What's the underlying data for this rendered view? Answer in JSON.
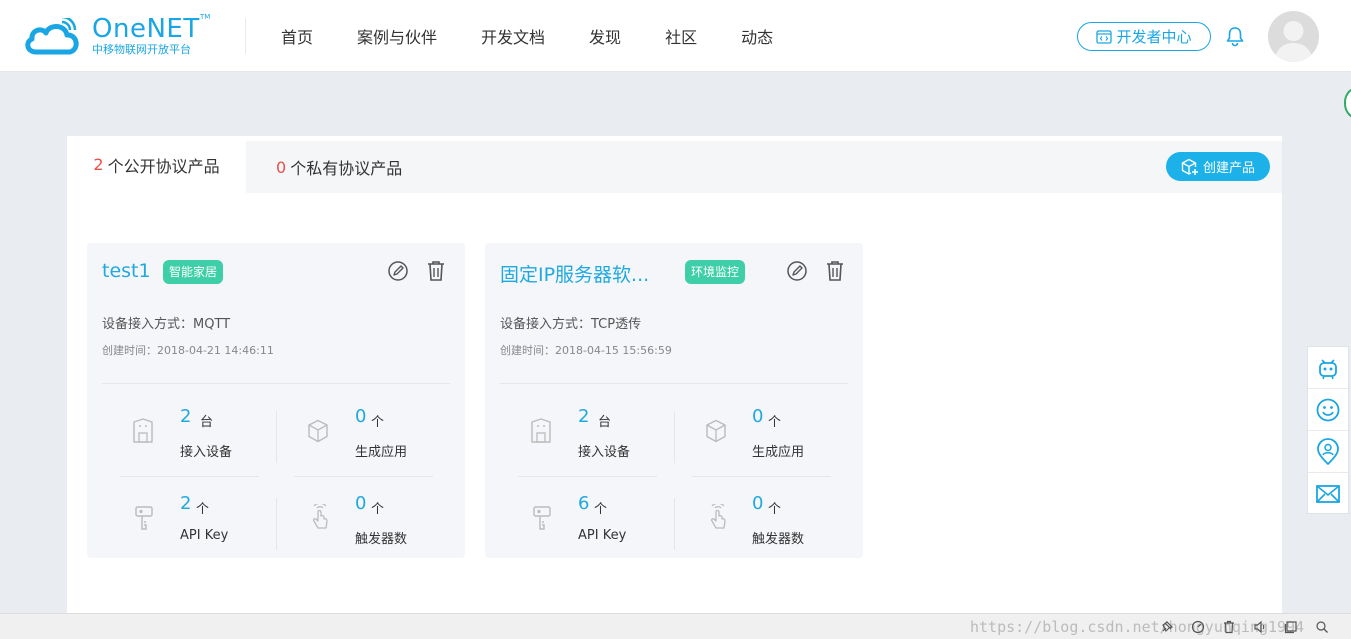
{
  "header": {
    "logo_name": "OneNET",
    "logo_tm": "TM",
    "logo_subtitle": "中移物联网开放平台",
    "nav": [
      "首页",
      "案例与伙伴",
      "开发文档",
      "发现",
      "社区",
      "动态"
    ],
    "dev_center_label": "开发者中心"
  },
  "tabs": {
    "public_count": "2",
    "public_label": "个公开协议产品",
    "private_count": "0",
    "private_label": "个私有协议产品"
  },
  "create_label": "创建产品",
  "products": [
    {
      "title": "test1",
      "tag": "智能家居",
      "access": "设备接入方式：MQTT",
      "created": "创建时间：2018-04-21 14:46:11",
      "devices_value": "2",
      "devices_unit": "台",
      "devices_label": "接入设备",
      "apps_value": "0",
      "apps_unit": "个",
      "apps_label": "生成应用",
      "apikey_value": "2",
      "apikey_unit": "个",
      "apikey_label": "API Key",
      "triggers_value": "0",
      "triggers_unit": "个",
      "triggers_label": "触发器数"
    },
    {
      "title": "固定IP服务器软...",
      "tag": "环境监控",
      "access": "设备接入方式：TCP透传",
      "created": "创建时间：2018-04-15 15:56:59",
      "devices_value": "2",
      "devices_unit": "台",
      "devices_label": "接入设备",
      "apps_value": "0",
      "apps_unit": "个",
      "apps_label": "生成应用",
      "apikey_value": "6",
      "apikey_unit": "个",
      "apikey_label": "API Key",
      "triggers_value": "0",
      "triggers_unit": "个",
      "triggers_label": "触发器数"
    }
  ],
  "side_tools": [
    "robot-icon",
    "smile-icon",
    "location-user-icon",
    "mail-icon"
  ],
  "watermark": "https://blog.csdn.net/hongyunqing1994",
  "colors": {
    "accent": "#1aa6e4",
    "tag": "#3ecfa8",
    "count_red": "#e8514a"
  }
}
